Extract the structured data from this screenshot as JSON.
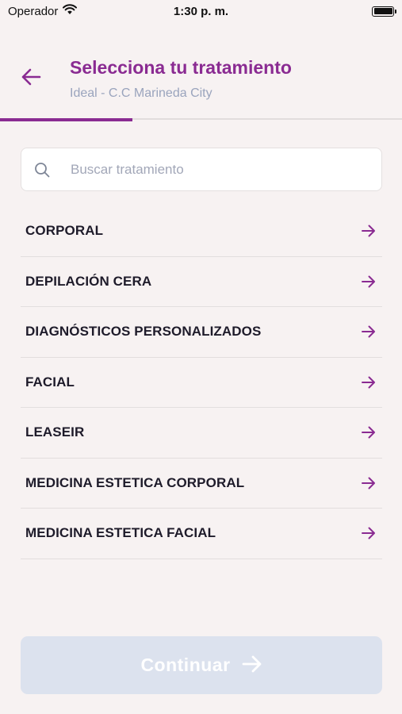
{
  "status_bar": {
    "carrier": "Operador",
    "time": "1:30 p. m.",
    "battery_level": 1.0
  },
  "header": {
    "title": "Selecciona tu tratamiento",
    "subtitle": "Ideal - C.C Marineda City",
    "progress": 0.33
  },
  "search": {
    "placeholder": "Buscar tratamiento",
    "value": ""
  },
  "treatments": [
    "CORPORAL",
    "DEPILACIÓN CERA",
    "DIAGNÓSTICOS PERSONALIZADOS",
    "FACIAL",
    "LEASEIR",
    "MEDICINA ESTETICA CORPORAL",
    "MEDICINA ESTETICA FACIAL"
  ],
  "footer": {
    "continue_label": "Continuar"
  },
  "colors": {
    "accent": "#8a2b92",
    "background": "#f7f2f2",
    "disabled_button": "#dce2ee",
    "subtitle": "#9aa4bd"
  },
  "icons": {
    "back": "arrow-left-icon",
    "search": "search-icon",
    "row": "arrow-right-icon",
    "continue": "arrow-right-icon"
  }
}
